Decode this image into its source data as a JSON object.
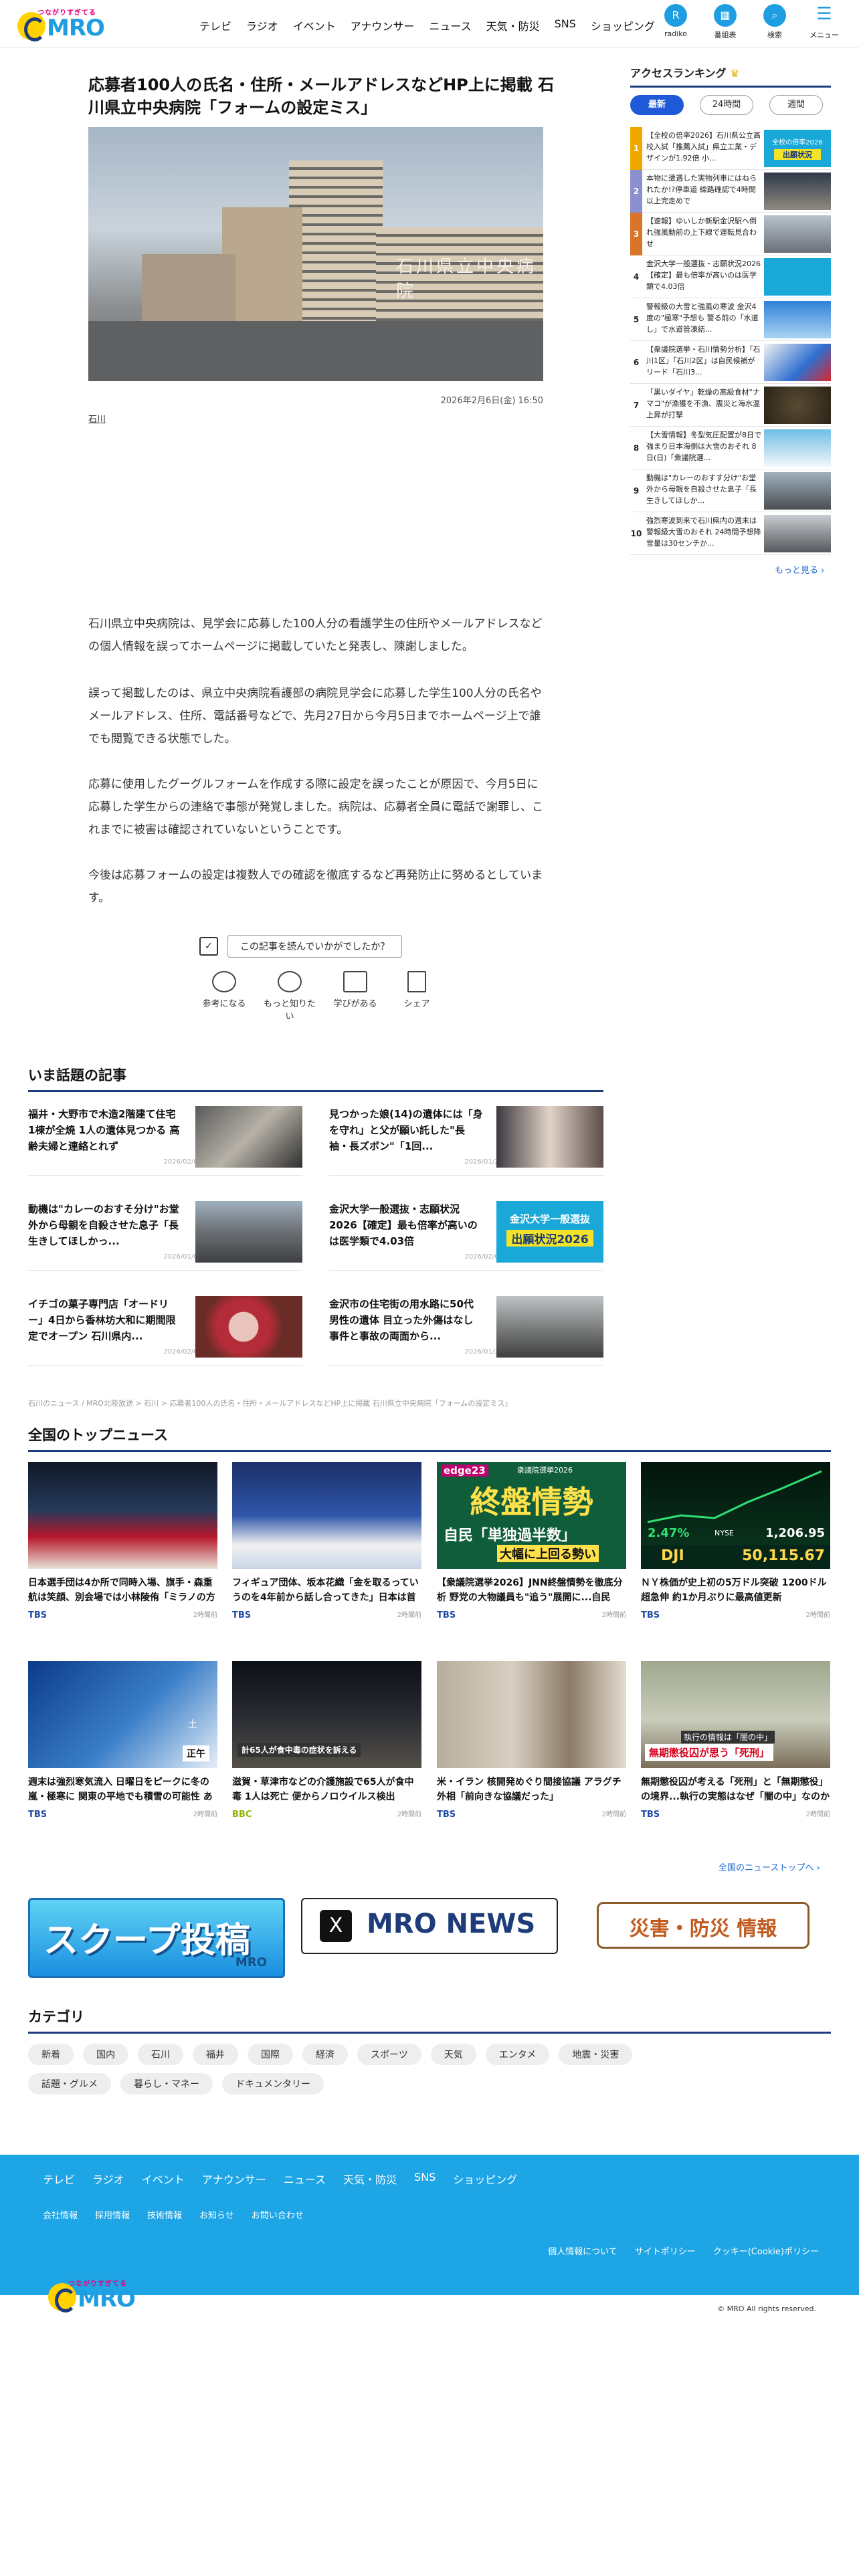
{
  "header": {
    "nav": [
      "テレビ",
      "ラジオ",
      "イベント",
      "アナウンサー",
      "ニュース",
      "天気・防災",
      "SNS",
      "ショッピング"
    ],
    "icons": [
      {
        "label": "radiko",
        "icon": "radiko-icon"
      },
      {
        "label": "番組表",
        "icon": "calendar-icon"
      },
      {
        "label": "検索",
        "icon": "search-icon"
      },
      {
        "label": "メニュー",
        "icon": "menu-icon"
      }
    ],
    "logo_text": "MRO",
    "logo_tagline": "つながりすぎてる"
  },
  "article": {
    "title": "応募者100人の氏名・住所・メールアドレスなどHP上に掲載 石川県立中央病院「フォームの設定ミス」",
    "photo_sign": "石川県立中央病院",
    "date": "2026年2月6日(金) 16:50",
    "tag": "石川",
    "paragraphs": [
      "石川県立中央病院は、見学会に応募した100人分の看護学生の住所やメールアドレスなどの個人情報を誤ってホームページに掲載していたと発表し、陳謝しました。",
      "誤って掲載したのは、県立中央病院看護部の病院見学会に応募した学生100人分の氏名やメールアドレス、住所、電話番号などで、先月27日から今月5日までホームページ上で誰でも閲覧できる状態でした。",
      "応募に使用したグーグルフォームを作成する際に設定を誤ったことが原因で、今月5日に応募した学生からの連絡で事態が発覚しました。病院は、応募者全員に電話で謝罪し、これまでに被害は確認されていないということです。",
      "今後は応募フォームの設定は複数人での確認を徹底するなど再発防止に努めるとしています。"
    ],
    "recommend": "この記事を読んでいかがでしたか？",
    "reactions": [
      "参考になる",
      "もっと知りたい",
      "学びがある",
      "シェア"
    ]
  },
  "ranking": {
    "title": "アクセスランキング",
    "tabs": [
      "最新",
      "24時間",
      "週間"
    ],
    "items": [
      {
        "rank": "1",
        "text": "【全校の倍率2026】石川県公立高校入試「推薦入試」県立工業・デザインが1.92倍 小..."
      },
      {
        "rank": "2",
        "text": "本物に遭遇した実物列車にはねられたか!?停車道 線路確認で4時間以上完走めで"
      },
      {
        "rank": "3",
        "text": "【速報】ゆいしか新駅金沢駅へ倒れ強風動前の上下線で運転見合わせ"
      },
      {
        "rank": "4",
        "text": "金沢大学一般選抜・志願状況2026【確定】最も倍率が高いのは医学類で4.03倍"
      },
      {
        "rank": "5",
        "text": "警報級の大雪と強風の寒波 金沢4度の\"極寒\"予想も 警る前の「水道し」で水道管凍結..."
      },
      {
        "rank": "6",
        "text": "【衆議院選挙・石川情勢分析】「石川1区」「石川2区」は自民候補がリード「石川3..."
      },
      {
        "rank": "7",
        "text": "「黒いダイヤ」乾燥の高級食材\"ナマコ\"が漁獲を不漁、震災と海水温上昇が打撃"
      },
      {
        "rank": "8",
        "text": "【大雪情報】冬型気圧配置が8日で強まり日本海側は大雪のおそれ 8日(日)「衆議院選..."
      },
      {
        "rank": "9",
        "text": "動機は\"カレーのおすす分け\"お堂外から母親を自殺させた息子「長生きしてほしか..."
      },
      {
        "rank": "10",
        "text": "強烈寒波到来で石川県内の週末は警報級大雪のおそれ 24時間予想降雪量は30センチか..."
      }
    ],
    "more": "もっと見る"
  },
  "topics": {
    "title": "いま話題の記事",
    "items": [
      {
        "title": "福井・大野市で木造2階建て住宅1棟が全焼 1人の遺体見つかる 高齢夫婦と連絡とれず",
        "date": "2026/02/06"
      },
      {
        "title": "見つかった娘(14)の遺体には「身を守れ」と父が願い託した\"長袖・長ズボン\"「1回...",
        "date": "2026/01/22"
      },
      {
        "title": "動機は\"カレーのおすそ分け\"お堂外から母親を自殺させた息子「長生きしてほしかっ...",
        "date": "2026/01/06"
      },
      {
        "title": "金沢大学一般選抜・志願状況2026【確定】最も倍率が高いのは医学類で4.03倍",
        "date": "2026/02/04"
      },
      {
        "title": "イチゴの菓子専門店「オードリー」4日から香林坊大和に期間限定でオープン 石川県内...",
        "date": "2026/02/04"
      },
      {
        "title": "金沢市の住宅街の用水路に50代男性の遺体 目立った外傷はなし 事件と事故の両面から...",
        "date": "2026/01/31"
      }
    ]
  },
  "breadcrumb": "石川のニュース / MRO北陸放送 > 石川 > 応募者100人の氏名・住所・メールアドレスなどHP上に掲載 石川県立中央病院「フォームの設定ミス」",
  "national": {
    "title": "全国のトップニュース",
    "items": [
      {
        "title": "日本選手団は4か所で同時入場、旗手・森重航は笑顔、別会場では小林陵侑「ミラノの方が楽しそう...」もノリ...",
        "source": "TBS",
        "ago": "2時間前"
      },
      {
        "title": "フィギュア団体、坂本花織「金を取るっていうのを4年前から話し合ってきた」日本は首位米国と僅差の2位発進",
        "source": "TBS",
        "ago": "2時間前"
      },
      {
        "title": "【衆議院選挙2026】JNN終盤情勢を徹底分析 野党の大物議員も\"追う\"展開に...自民「単独過半数」大幅上回る...",
        "source": "TBS",
        "ago": "2時間前"
      },
      {
        "title": "ＮＹ株価が史上初の5万ドル突破 1200ドル超急伸 約1か月ぶりに最高値更新",
        "source": "TBS",
        "ago": "2時間前"
      },
      {
        "title": "週末は強烈寒気流入 日曜日をピークに冬の嵐・極寒に 関東の平地でも積雪の可能性 あらたな大雪災害に警戒",
        "source": "TBS",
        "ago": "2時間前"
      },
      {
        "title": "滋賀・草津市などの介護施設で65人が食中毒 1人は死亡 便からノロウイルス検出",
        "source": "BBC",
        "ago": "2時間前"
      },
      {
        "title": "米・イラン 核開発めぐり間接協議 アラグチ外相「前向きな協議だった」",
        "source": "TBS",
        "ago": "2時間前"
      },
      {
        "title": "無期懲役囚が考える「死刑」と「無期懲役」の境界...執行の実態はなぜ「闇の中」なのか【報道特集】",
        "source": "TBS",
        "ago": "2時間前"
      }
    ],
    "thumb_text": {
      "edge": "edge23",
      "vote": "衆議院選挙2026",
      "final": "終盤情勢",
      "majority": "自民「単独過半数」",
      "exceed": "大幅に上回る勢い",
      "nyse": "NYSE",
      "pct": "2.47%",
      "val1": "1,206.95",
      "dji": "DJI",
      "val2": "50,115.67",
      "prison": "無期懲役囚が思う「死刑」",
      "prison_sub": "執行の情報は「闇の中」",
      "care": "計65人が食中毒の症状を訴える",
      "weather": "土",
      "weather2": "正午"
    },
    "more": "全国のニューストップへ"
  },
  "banners": {
    "scoop": "スクープ投稿",
    "scoop_sub": "MRO",
    "news": "MRO NEWS",
    "disaster": "災害・防災 情報"
  },
  "topics_thumb": {
    "exam1": "金沢大学一般選抜",
    "exam2": "出願状況2026",
    "rk_exam1": "全校の倍率2026",
    "rk_exam2": "出願状況"
  },
  "categories": {
    "title": "カテゴリ",
    "items": [
      "新着",
      "国内",
      "石川",
      "福井",
      "国際",
      "経済",
      "スポーツ",
      "天気",
      "エンタメ",
      "地震・災害",
      "話題・グルメ",
      "暮らし・マネー",
      "ドキュメンタリー"
    ]
  },
  "footer": {
    "nav": [
      "テレビ",
      "ラジオ",
      "イベント",
      "アナウンサー",
      "ニュース",
      "天気・防災",
      "SNS",
      "ショッピング"
    ],
    "sub": [
      "会社情報",
      "採用情報",
      "技術情報",
      "お知らせ",
      "お問い合わせ"
    ],
    "policy": [
      "個人情報について",
      "サイトポリシー",
      "クッキー(Cookie)ポリシー"
    ],
    "copyright": "© MRO All rights reserved."
  },
  "colors": {
    "accent": "#1e9ee0",
    "navy": "#1e3c7a",
    "footer": "#1ea5e6",
    "tab_on": "#1e5ad8"
  }
}
